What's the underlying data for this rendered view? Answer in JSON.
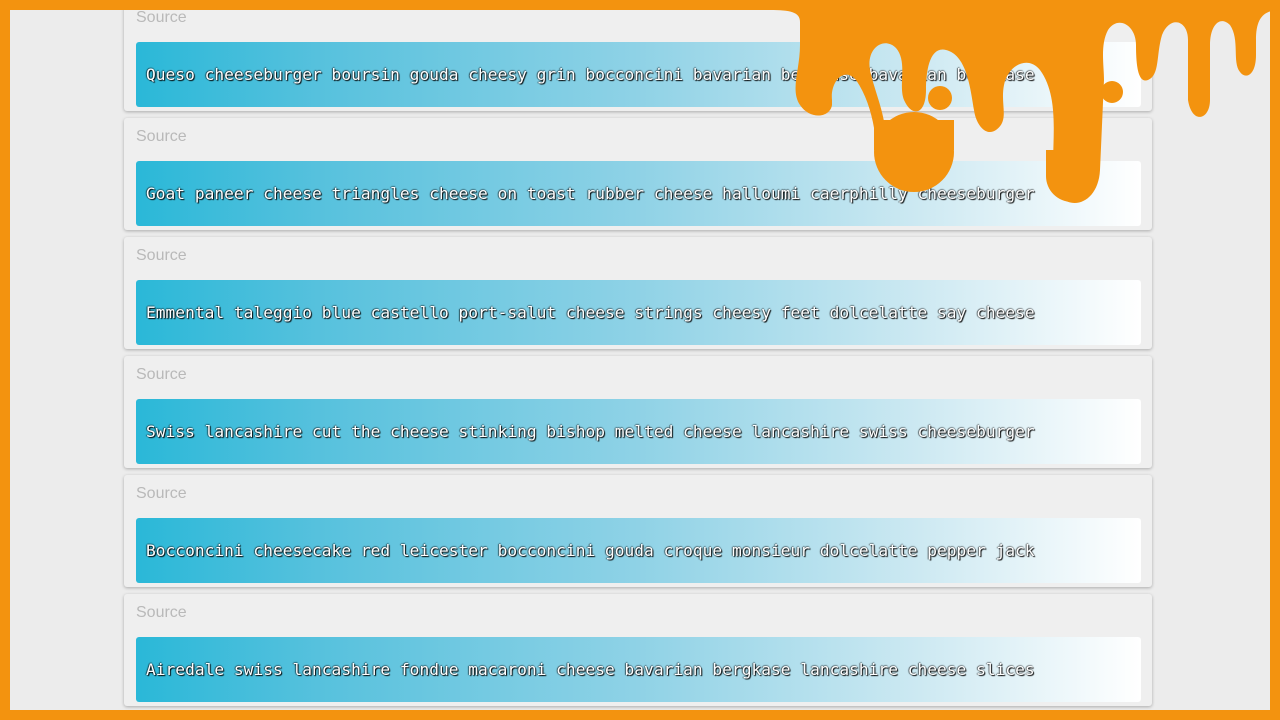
{
  "cards": [
    {
      "label": "Source",
      "text": "Queso cheeseburger boursin gouda cheesy grin bocconcini bavarian bergkase bavarian bergkase"
    },
    {
      "label": "Source",
      "text": "Goat paneer cheese triangles cheese on toast rubber cheese halloumi caerphilly cheeseburger"
    },
    {
      "label": "Source",
      "text": "Emmental taleggio blue castello port-salut cheese strings cheesy feet dolcelatte say cheese"
    },
    {
      "label": "Source",
      "text": "Swiss lancashire cut the cheese stinking bishop melted cheese lancashire swiss cheeseburger"
    },
    {
      "label": "Source",
      "text": "Bocconcini cheesecake red leicester bocconcini gouda croque monsieur dolcelatte pepper jack"
    },
    {
      "label": "Source",
      "text": "Airedale swiss lancashire fondue macaroni cheese bavarian bergkase lancashire cheese slices"
    }
  ],
  "colors": {
    "frame": "#f3930f",
    "background": "#ececec",
    "gradient_start": "#2ab8d8",
    "gradient_end": "#ffffff",
    "label": "#b9b9b9"
  },
  "icons": {
    "overlay": "cheese-drip-graphic"
  }
}
